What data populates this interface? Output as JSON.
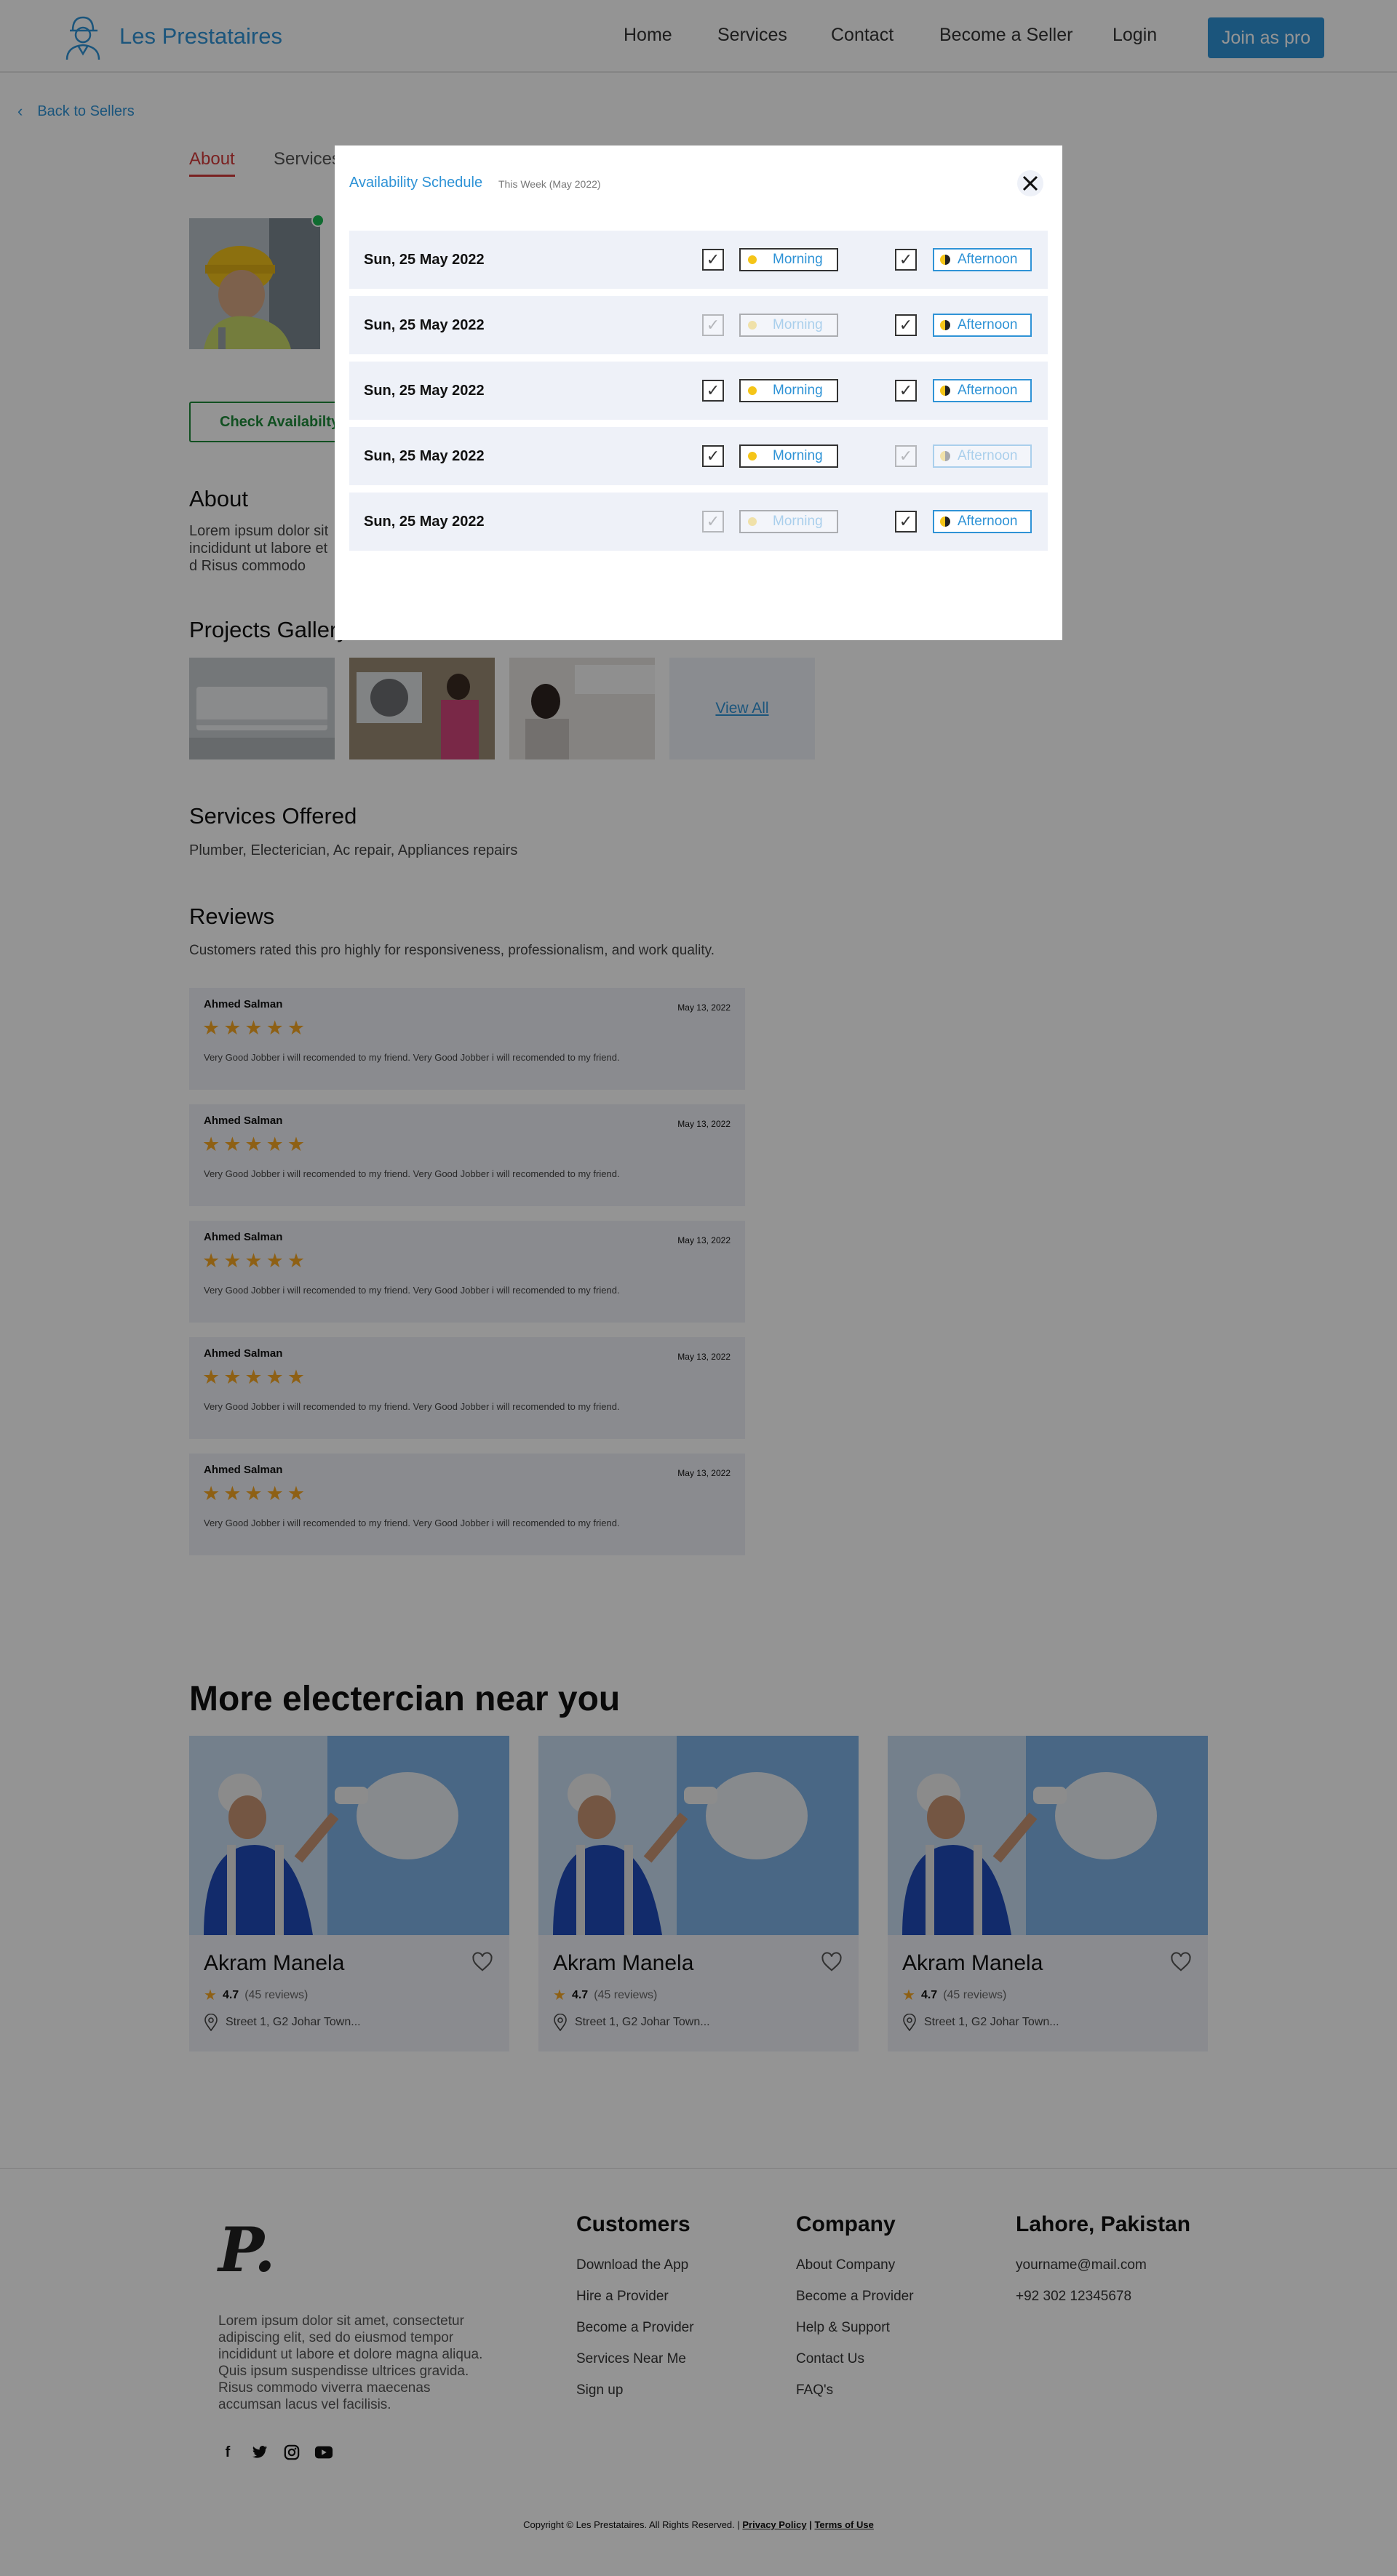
{
  "header": {
    "brand": "Les Prestataires",
    "nav": [
      "Home",
      "Services",
      "Contact",
      "Become a Seller",
      "Login"
    ],
    "join": "Join as pro"
  },
  "page": {
    "back": "Back to Sellers",
    "tabs": [
      "About",
      "Services"
    ],
    "check_availability": "Check Availabilty",
    "about_title": "About",
    "about_text": "Lorem ipsum dolor sit incididunt ut labore et d Risus commodo viverra",
    "gallery_title": "Projects Gallery",
    "view_all": "View All",
    "services_title": "Services Offered",
    "services_text": "Plumber, Electerician, Ac repair, Appliances repairs",
    "reviews_title": "Reviews",
    "reviews_sub": "Customers rated this pro highly for responsiveness, professionalism, and work quality.",
    "reviews": [
      {
        "name": "Ahmed Salman",
        "date": "May 13, 2022",
        "rating": 5,
        "stars": "★★★★★",
        "text": "Very Good Jobber i will  recomended to my friend. Very Good Jobber i will  recomended to my friend."
      },
      {
        "name": "Ahmed Salman",
        "date": "May 13, 2022",
        "rating": 5,
        "stars": "★★★★★",
        "text": "Very Good Jobber i will  recomended to my friend. Very Good Jobber i will  recomended to my friend."
      },
      {
        "name": "Ahmed Salman",
        "date": "May 13, 2022",
        "rating": 5,
        "stars": "★★★★★",
        "text": "Very Good Jobber i will  recomended to my friend. Very Good Jobber i will  recomended to my friend."
      },
      {
        "name": "Ahmed Salman",
        "date": "May 13, 2022",
        "rating": 5,
        "stars": "★★★★★",
        "text": "Very Good Jobber i will  recomended to my friend. Very Good Jobber i will  recomended to my friend."
      },
      {
        "name": "Ahmed Salman",
        "date": "May 13, 2022",
        "rating": 5,
        "stars": "★★★★★",
        "text": "Very Good Jobber i will  recomended to my friend. Very Good Jobber i will  recomended to my friend."
      }
    ],
    "more_title": "More electercian near you",
    "pros": [
      {
        "name": "Akram Manela",
        "rating": "4.7",
        "reviews": "(45 reviews)",
        "address": "Street 1, G2 Johar Town..."
      },
      {
        "name": "Akram Manela",
        "rating": "4.7",
        "reviews": "(45 reviews)",
        "address": "Street 1, G2 Johar Town..."
      },
      {
        "name": "Akram Manela",
        "rating": "4.7",
        "reviews": "(45 reviews)",
        "address": "Street 1, G2 Johar Town..."
      }
    ]
  },
  "footer": {
    "logo": "P.",
    "desc": "Lorem ipsum dolor sit amet, consectetur adipiscing elit, sed do eiusmod tempor incididunt ut labore et dolore magna aliqua. Quis ipsum suspendisse ultrices gravida. Risus commodo viverra maecenas accumsan lacus vel facilisis.",
    "customers_title": "Customers",
    "customers": [
      "Download the App",
      "Hire a Provider",
      "Become a Provider",
      "Services Near Me",
      "Sign up"
    ],
    "company_title": "Company",
    "company": [
      "About Company",
      "Become a Provider",
      "Help & Support",
      "Contact Us",
      "FAQ's"
    ],
    "location_title": "Lahore, Pakistan",
    "email": "yourname@mail.com",
    "phone": "+92 302 12345678",
    "copyright": "Copyright © Les Prestataires. All Rights Reserved. |",
    "privacy": "Privacy Policy",
    "sep": "|",
    "terms": "Terms of Use"
  },
  "modal": {
    "title": "Availability Schedule",
    "subtitle": "This Week (May 2022)",
    "morning_label": "Morning",
    "afternoon_label": "Afternoon",
    "rows": [
      {
        "date": "Sun,  25 May 2022",
        "morning": true,
        "afternoon": true
      },
      {
        "date": "Sun,  25 May 2022",
        "morning": false,
        "afternoon": true
      },
      {
        "date": "Sun,  25 May 2022",
        "morning": true,
        "afternoon": true
      },
      {
        "date": "Sun,  25 May 2022",
        "morning": true,
        "afternoon": false
      },
      {
        "date": "Sun,  25 May 2022",
        "morning": false,
        "afternoon": true
      }
    ]
  },
  "colors": {
    "accent": "#2f93d6",
    "active_tab": "#d33a3a",
    "check": "#1e8a3a",
    "star": "#f5a623"
  }
}
